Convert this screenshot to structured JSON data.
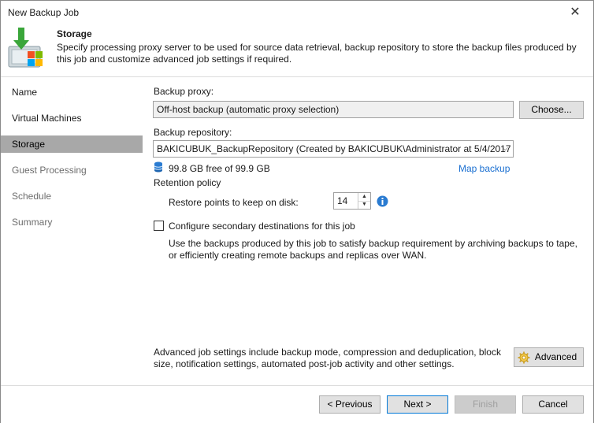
{
  "window": {
    "title": "New Backup Job",
    "close_glyph": "✕"
  },
  "header": {
    "title": "Storage",
    "description": "Specify processing proxy server to be used for source data retrieval, backup repository to store the backup files produced by this job and customize advanced job settings if required."
  },
  "nav": {
    "items": [
      {
        "label": "Name",
        "state": "normal"
      },
      {
        "label": "Virtual Machines",
        "state": "normal"
      },
      {
        "label": "Storage",
        "state": "active"
      },
      {
        "label": "Guest Processing",
        "state": "disabled"
      },
      {
        "label": "Schedule",
        "state": "disabled"
      },
      {
        "label": "Summary",
        "state": "disabled"
      }
    ]
  },
  "storage": {
    "proxy_label": "Backup proxy:",
    "proxy_value": "Off-host backup (automatic proxy selection)",
    "choose_label": "Choose...",
    "repository_label": "Backup repository:",
    "repository_value": "BAKICUBUK_BackupRepository (Created by BAKICUBUK\\Administrator at 5/4/2017",
    "free_space": "99.8 GB free of 99.9 GB",
    "map_backup_label": "Map backup",
    "retention_label": "Retention policy",
    "restore_points_label": "Restore points to keep on disk:",
    "restore_points_value": "14",
    "secondary_label": "Configure secondary destinations for this job",
    "secondary_checked": false,
    "secondary_description": "Use the backups produced by this job to satisfy backup requirement by archiving backups to tape, or efficiently creating remote backups and replicas over WAN.",
    "advanced_description": "Advanced job settings include backup mode, compression and deduplication, block size, notification settings, automated post-job activity and other settings.",
    "advanced_label": "Advanced"
  },
  "footer": {
    "previous_label": "< Previous",
    "next_label": "Next >",
    "finish_label": "Finish",
    "cancel_label": "Cancel"
  },
  "colors": {
    "accent": "#0078d7",
    "link": "#1a6fd1",
    "nav_active": "#a8a8a8"
  },
  "icons": [
    "backup-job-logo-icon",
    "database-icon",
    "info-icon",
    "gear-icon",
    "spinner-up-icon",
    "spinner-down-icon",
    "dropdown-chevron-icon",
    "close-icon"
  ]
}
